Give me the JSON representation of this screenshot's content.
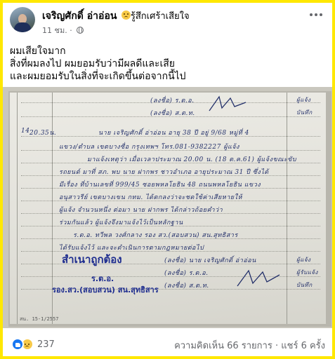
{
  "post": {
    "author": "เจริญศักดิ์ อ่าอ่อน",
    "feeling": "รู้สึกเศร้าเสียใจ",
    "feeling_icon": "sad-face-icon",
    "timestamp": "11 ชม.",
    "privacy_icon": "globe-icon",
    "text_lines": [
      "ผมเสียใจมาก",
      "สิ่งที่ผมลงไป ผมยอมรับว่ามีผลดีและเสีย",
      "และผมยอมรับในสิ่งที่จะเกิดขึ้นต่อจากนี้ไป"
    ]
  },
  "photo": {
    "doc_header_lines": [
      "(ลงชื่อ) ร.ต.อ.",
      "(ลงชื่อ) ส.ต.ท."
    ],
    "side_labels": [
      "ผู้แจ้ง",
      "บันทึก"
    ],
    "entry_number": "14",
    "entry_time": "20.35น.",
    "handwritten_lines": [
      "นาย เจริญศักดิ์ อ่าอ่อน อายุ 38 ปี อยู่ 9/68 หมู่ที่ 4",
      "แขวง/ตำบล เขตบางซื่อ กรุงเทพฯ โทร.081-9382227 ผู้แจ้ง",
      "มาแจ้งเหตุว่า เมื่อเวลาประมาณ 20.00 น. (18 ต.ค.61) ผู้แจ้งขณะขับ",
      "รถยนต์ มาที่ สภ. พบ นาย ฝากพร ชาวอำเภอ อายุประมาณ 31 ปี ซึ่งได้",
      "มีเรื่อง ที่บ้านเลขที่ 999/45 ซอยพหลโยธิน 48 ถนนพหลโยธิน แขวง",
      "อนุสาวรีย์ เขตบางเขน กทม. ได้ตกลงว่าจะชดใช้ค่าเสียหายให้",
      "ผู้แจ้ง จำนวนหนึ่ง ต่อมา นาย ฝากพร ได้กล่าวถ้อยคำว่า",
      "ร่วมกันแล้ว ผู้แจ้งจึงมาแจ้งไว้เป็นหลักฐาน",
      "ร.ต.อ. ทวีพล วงศ์กลาง รอง สว.(สอบสวน) สน.สุทธิสาร",
      "ได้รับแจ้งไว้ และจะดำเนินการตามกฎหมายต่อไป"
    ],
    "stamp_main": "สำเนาถูกต้อง",
    "stamp_rank": "ร.ต.อ.",
    "stamp_position": "รอง.สว.(สอบสวน) สน.สุทธิสาร",
    "sign_lines": [
      "(ลงชื่อ) นาย เจริญศักดิ์ อ่าอ่อน",
      "(ลงชื่อ) ร.ต.อ.",
      "(ลงชื่อ) ส.ต.ท."
    ],
    "sign_labels": [
      "ผู้แจ้ง",
      "ผู้รับแจ้ง",
      "บันทึก"
    ],
    "form_code": "สน. 15-1/2557"
  },
  "footer": {
    "reaction_icons": [
      "like-icon",
      "sad-icon"
    ],
    "reaction_count": "237",
    "comments": "ความคิดเห็น 66 รายการ",
    "shares": "แชร์ 6 ครั้ง"
  },
  "colors": {
    "frame": "#ffe800",
    "facebook_blue": "#1877f2",
    "meta_text": "#65676b",
    "ink": "#23306a",
    "stamp_blue": "#1e2d8f"
  }
}
